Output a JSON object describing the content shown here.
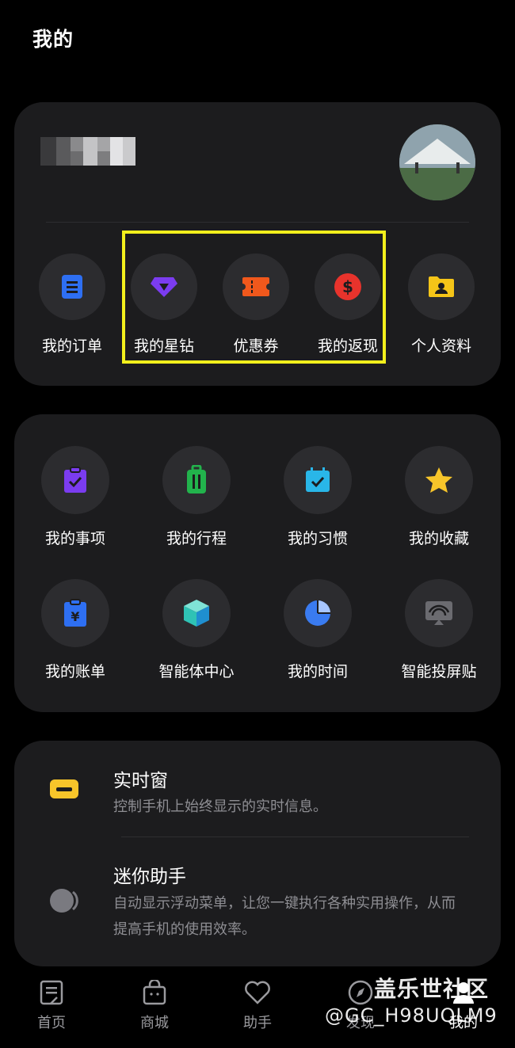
{
  "page": {
    "title": "我的"
  },
  "quick_actions": [
    {
      "label": "我的订单",
      "icon": "order-icon",
      "color": "#2e6ff2"
    },
    {
      "label": "我的星钻",
      "icon": "diamond-icon",
      "color": "#7b3cf0"
    },
    {
      "label": "优惠券",
      "icon": "coupon-icon",
      "color": "#f0581c"
    },
    {
      "label": "我的返现",
      "icon": "cashback-icon",
      "color": "#e8332c"
    },
    {
      "label": "个人资料",
      "icon": "profile-folder-icon",
      "color": "#f5c518"
    }
  ],
  "highlight_color": "#f2ef1c",
  "features": [
    {
      "label": "我的事项",
      "icon": "task-clipboard-icon",
      "color": "#7b3cf0"
    },
    {
      "label": "我的行程",
      "icon": "luggage-icon",
      "color": "#22b34c"
    },
    {
      "label": "我的习惯",
      "icon": "habit-calendar-icon",
      "color": "#29b6e8"
    },
    {
      "label": "我的收藏",
      "icon": "star-icon",
      "color": "#f7c52a"
    },
    {
      "label": "我的账单",
      "icon": "bill-icon",
      "color": "#2e6ff2"
    },
    {
      "label": "智能体中心",
      "icon": "agent-cube-icon",
      "color": "#2fc3b5"
    },
    {
      "label": "我的时间",
      "icon": "pie-time-icon",
      "color": "#3a7bf0"
    },
    {
      "label": "智能投屏贴",
      "icon": "cast-icon",
      "color": "#6b6b70"
    }
  ],
  "settings": [
    {
      "title": "实时窗",
      "desc": "控制手机上始终显示的实时信息。",
      "icon": "live-window-icon",
      "color": "#f7c52a"
    },
    {
      "title": "迷你助手",
      "desc": "自动显示浮动菜单，让您一键执行各种实用操作，从而提高手机的使用效率。",
      "icon": "mini-assistant-icon",
      "color": "#7a7a80"
    }
  ],
  "bottom_nav": [
    {
      "label": "首页",
      "icon": "home-icon"
    },
    {
      "label": "商城",
      "icon": "shop-bag-icon"
    },
    {
      "label": "助手",
      "icon": "heart-icon"
    },
    {
      "label": "发现",
      "icon": "compass-icon"
    },
    {
      "label": "我的",
      "icon": "me-icon",
      "active": true
    }
  ],
  "watermark": {
    "brand": "盖乐世社区",
    "user": "@GC_H98UQLM9"
  }
}
